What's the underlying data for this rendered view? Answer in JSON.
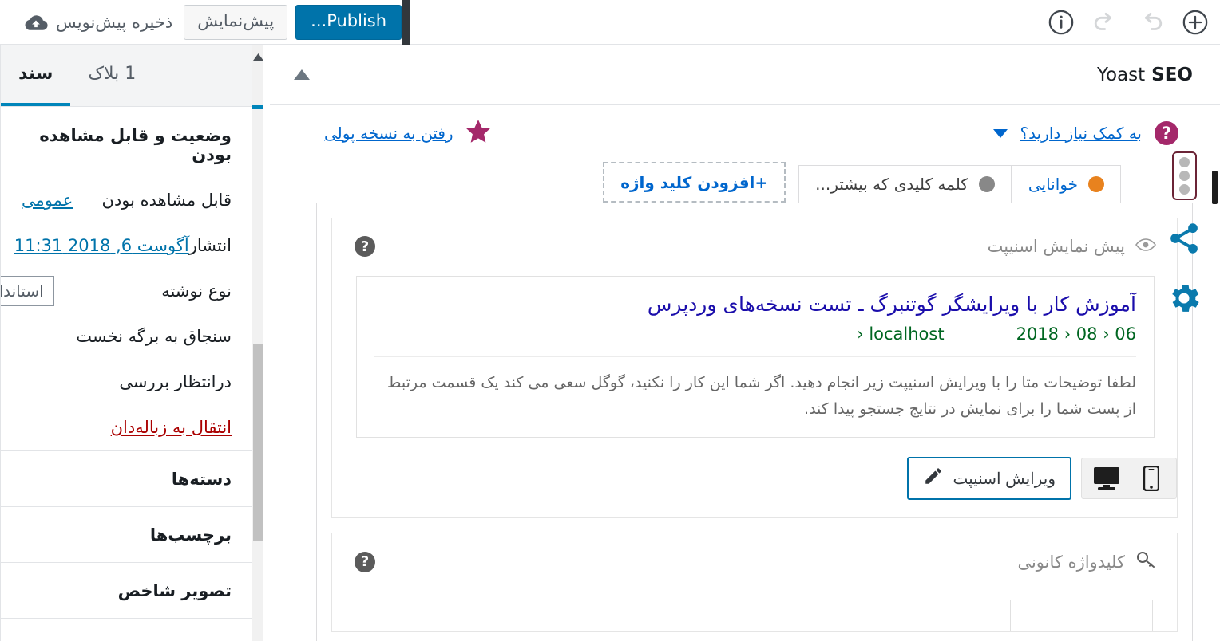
{
  "topbar": {
    "publish_label": "Publish...",
    "preview_label": "پیش‌نمایش",
    "save_draft_label": "ذخیره پیش‌نویس",
    "icons": {
      "cloud": "cloud-upload-icon",
      "info": "info-icon",
      "redo": "redo-icon",
      "undo": "undo-icon",
      "add": "add-block-icon"
    }
  },
  "sidebar": {
    "tabs": [
      {
        "label": "سند",
        "active": true
      },
      {
        "label": "1 بلاک",
        "active": false
      }
    ],
    "status_section_title": "وضعیت و قابل مشاهده بودن",
    "rows": [
      {
        "label": "قابل مشاهده بودن",
        "value": "عمومی"
      },
      {
        "label": "انتشار",
        "value": "آگوست 6, 2018 11:31"
      },
      {
        "label": "نوع نوشته",
        "value": "استاندارد"
      },
      {
        "label": "سنجاق به برگه نخست",
        "value": ""
      },
      {
        "label": "درانتظار بررسی",
        "value": ""
      }
    ],
    "trash_label": "انتقال به زباله‌دان",
    "panels": [
      {
        "label": "دسته‌ها"
      },
      {
        "label": "برچسب‌ها"
      },
      {
        "label": "تصویر شاخص"
      }
    ]
  },
  "yoast": {
    "title_thin": "Yoast",
    "title_bold": "SEO",
    "help_link": "به کمک نیاز دارید؟",
    "premium_link": "رفتن به نسخه پولی",
    "tabs": [
      {
        "label": "خوانایی",
        "dot_color": "#e8821e"
      },
      {
        "label": "کلمه کلیدی که بیشتر...",
        "dot_color": "#888888"
      }
    ],
    "add_keyword_label": "+افزودن کلید واژه",
    "snippet": {
      "section_title": "پیش نمایش اسنیپت",
      "title": "آموزش کار با ویرایشگر گوتنبرگ ـ تست نسخه‌های وردپرس",
      "url_date": "06 ‹ 08 ‹ 2018",
      "url_host": "localhost ‹",
      "description": "لطفا توضیحات متا را با ویرایش اسنیپت زیر انجام دهید. اگر شما این کار را نکنید، گوگل سعی می کند یک قسمت مرتبط از پست شما را برای نمایش در نتایج جستجو پیدا کند.",
      "edit_button": "ویرایش اسنیپت",
      "device_desktop": "desktop-icon",
      "device_mobile": "mobile-icon"
    },
    "focus_keyword": {
      "section_title": "کلیدواژه کانونی",
      "input_value": "",
      "input_placeholder": ""
    },
    "rail": [
      {
        "name": "seo-score-traffic-light-icon"
      },
      {
        "name": "share-icon"
      },
      {
        "name": "gear-icon"
      }
    ]
  },
  "colors": {
    "publish_blue": "#0073aa",
    "accent_blue": "#0085ba",
    "link_blue": "#0066cd",
    "readability_orange": "#e8821e",
    "keyword_grey": "#888888",
    "premium_pink": "#a4286a",
    "snippet_title": "#1a0dab",
    "snippet_url": "#006621",
    "trash_red": "#aa0000"
  }
}
